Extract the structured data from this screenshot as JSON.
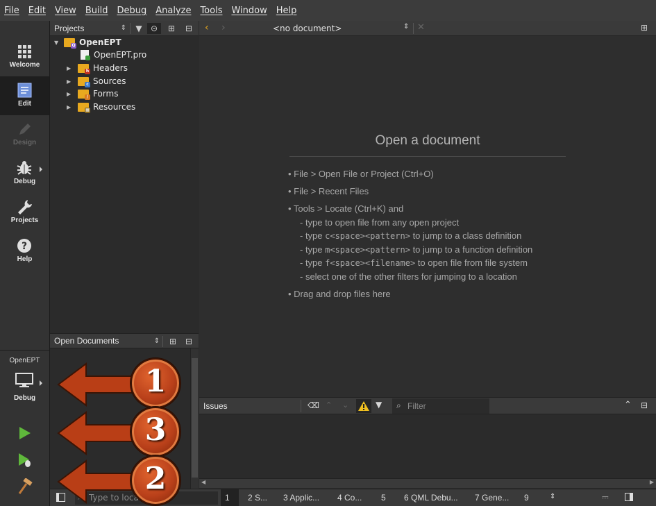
{
  "menu": [
    "File",
    "Edit",
    "View",
    "Build",
    "Debug",
    "Analyze",
    "Tools",
    "Window",
    "Help"
  ],
  "modes": [
    {
      "label": "Welcome",
      "icon": "grid-icon",
      "state": "normal"
    },
    {
      "label": "Edit",
      "icon": "document-icon",
      "state": "active"
    },
    {
      "label": "Design",
      "icon": "pencil-icon",
      "state": "disabled"
    },
    {
      "label": "Debug",
      "icon": "bug-icon",
      "state": "normal"
    },
    {
      "label": "Projects",
      "icon": "wrench-icon",
      "state": "normal"
    },
    {
      "label": "Help",
      "icon": "question-icon",
      "state": "normal"
    }
  ],
  "kit": {
    "project": "OpenEPT",
    "config": "Debug"
  },
  "projects_pane": {
    "title": "Projects"
  },
  "tree": {
    "root": "OpenEPT",
    "children": [
      {
        "label": "OpenEPT.pro",
        "kind": "pro-file",
        "expandable": false
      },
      {
        "label": "Headers",
        "kind": "folder-h",
        "expandable": true
      },
      {
        "label": "Sources",
        "kind": "folder-c",
        "expandable": true
      },
      {
        "label": "Forms",
        "kind": "folder-form",
        "expandable": true
      },
      {
        "label": "Resources",
        "kind": "folder-res",
        "expandable": true
      }
    ]
  },
  "open_documents": {
    "title": "Open Documents"
  },
  "editor": {
    "document_selector": "<no document>",
    "welcome_title": "Open a document",
    "tips": [
      "• File > Open File or Project (Ctrl+O)",
      "• File > Recent Files",
      "• Tools > Locate (Ctrl+K) and"
    ],
    "subtips": [
      {
        "pre": "- type ",
        "code": "c<space><pattern>",
        "post": " to jump to a class definition"
      },
      {
        "pre": "- type ",
        "code": "m<space><pattern>",
        "post": " to jump to a function definition"
      },
      {
        "pre": "- type ",
        "code": "f<space><filename>",
        "post": " to open file from file system"
      },
      {
        "pre": "- select one of the other filters for jumping to a location",
        "code": "",
        "post": ""
      }
    ],
    "drag_tip": "• Drag and drop files here"
  },
  "issues": {
    "title": "Issues",
    "filter_placeholder": "Filter"
  },
  "statusbar": {
    "locate_placeholder": "Type to locate",
    "tabs": [
      "1",
      "2 S...",
      "3 Applic...",
      "4 Co...",
      "5",
      "6 QML Debu...",
      "7 Gene...",
      "9"
    ]
  },
  "callouts": [
    "1",
    "3",
    "2"
  ],
  "colors": {
    "callout": "#c0451c",
    "run_green": "#5fb83b",
    "folder": "#e8a91f"
  }
}
